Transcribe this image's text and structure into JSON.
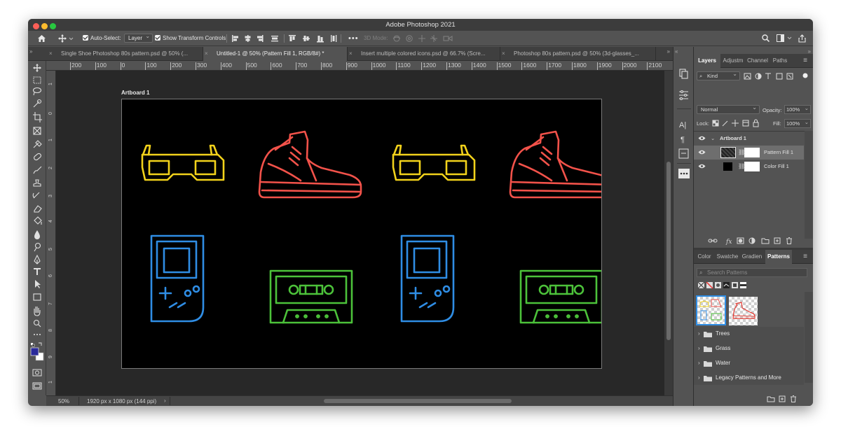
{
  "window": {
    "title": "Adobe Photoshop 2021"
  },
  "options_bar": {
    "auto_select_label": "Auto-Select:",
    "auto_select_value": "Layer",
    "show_transform_label": "Show Transform Controls",
    "mode_3d_label": "3D Mode:"
  },
  "doc_tabs": [
    {
      "label": "Single Shoe Photoshop 80s pattern.psd @ 50% (..."
    },
    {
      "label": "Untitled-1 @ 50% (Pattern Fill 1, RGB/8#) *"
    },
    {
      "label": "Insert multiple colored icons.psd @ 66.7% (Scre..."
    },
    {
      "label": "Photoshop 80s pattern.psd @ 50% (3d-glasses_..."
    }
  ],
  "ruler": {
    "labels": [
      "200",
      "100",
      "0",
      "100",
      "200",
      "300",
      "400",
      "500",
      "600",
      "700",
      "800",
      "900",
      "1000",
      "1100",
      "1200",
      "1300",
      "1400",
      "1500",
      "1600",
      "1700",
      "1800",
      "1900",
      "2000",
      "2100"
    ]
  },
  "artboard": {
    "label": "Artboard 1"
  },
  "status": {
    "zoom": "50%",
    "doc_info": "1920 px x 1080 px (144 ppi)"
  },
  "layers_panel": {
    "tabs": [
      "Layers",
      "Adjustm",
      "Channel",
      "Paths"
    ],
    "kind_filter": "Kind",
    "blend_mode": "Normal",
    "opacity_label": "Opacity:",
    "opacity_value": "100%",
    "lock_label": "Lock:",
    "fill_label": "Fill:",
    "fill_value": "100%",
    "layers": [
      {
        "name": "Artboard 1"
      },
      {
        "name": "Pattern Fill 1"
      },
      {
        "name": "Color Fill 1"
      }
    ]
  },
  "patterns_panel": {
    "tabs": [
      "Color",
      "Swatche",
      "Gradien",
      "Patterns"
    ],
    "search_placeholder": "Search Patterns",
    "groups": [
      {
        "name": "Trees"
      },
      {
        "name": "Grass"
      },
      {
        "name": "Water"
      },
      {
        "name": "Legacy Patterns and More"
      }
    ]
  },
  "colors": {
    "glasses": "#f2d21b",
    "shoe": "#f2524a",
    "gameboy": "#2f8de4",
    "cassette": "#4cc23a",
    "foreground": "#2a2a9a",
    "background": "#ffffff"
  }
}
